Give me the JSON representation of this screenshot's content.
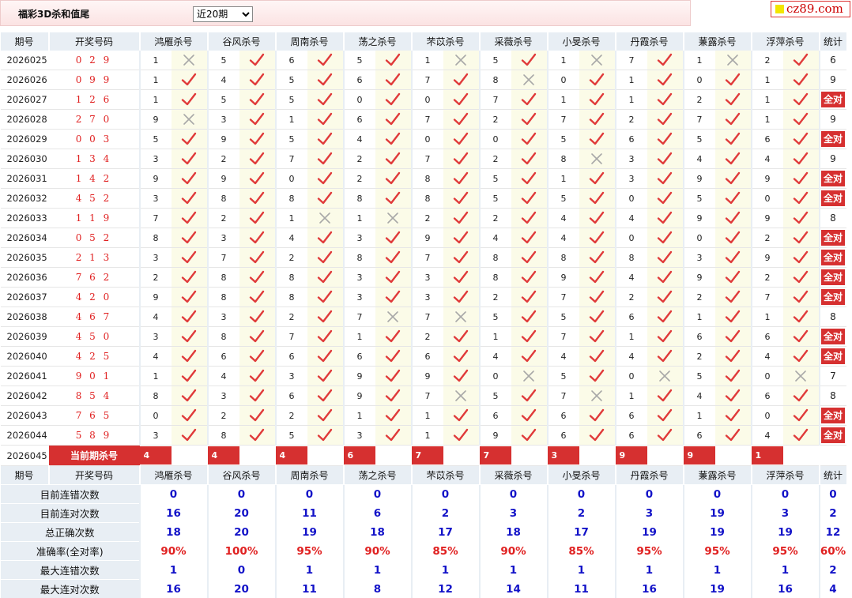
{
  "header": {
    "title": "福彩3D杀和值尾",
    "range_selected": "近20期",
    "logo_text": "cz89.com"
  },
  "columns": {
    "issue": "期号",
    "draw": "开奖号码",
    "experts": [
      "鸿雁杀号",
      "谷风杀号",
      "周南杀号",
      "荡之杀号",
      "芣苡杀号",
      "采薇杀号",
      "小旻杀号",
      "丹霞杀号",
      "蒹露杀号",
      "浮萍杀号"
    ],
    "stat": "统计"
  },
  "rows": [
    {
      "issue": "2026025",
      "draw": "0 2 9",
      "kills": [
        1,
        5,
        6,
        5,
        1,
        5,
        1,
        7,
        1,
        2
      ],
      "ok": [
        0,
        1,
        1,
        1,
        0,
        1,
        0,
        1,
        0,
        1
      ],
      "stat": "6",
      "all": false
    },
    {
      "issue": "2026026",
      "draw": "0 9 9",
      "kills": [
        1,
        4,
        5,
        6,
        7,
        8,
        0,
        1,
        0,
        1
      ],
      "ok": [
        1,
        1,
        1,
        1,
        1,
        0,
        1,
        1,
        1,
        1
      ],
      "stat": "9",
      "all": false
    },
    {
      "issue": "2026027",
      "draw": "1 2 6",
      "kills": [
        1,
        5,
        5,
        0,
        0,
        7,
        1,
        1,
        2,
        1
      ],
      "ok": [
        1,
        1,
        1,
        1,
        1,
        1,
        1,
        1,
        1,
        1
      ],
      "stat": "全对",
      "all": true
    },
    {
      "issue": "2026028",
      "draw": "2 7 0",
      "kills": [
        9,
        3,
        1,
        6,
        7,
        2,
        7,
        2,
        7,
        1
      ],
      "ok": [
        0,
        1,
        1,
        1,
        1,
        1,
        1,
        1,
        1,
        1
      ],
      "stat": "9",
      "all": false
    },
    {
      "issue": "2026029",
      "draw": "0 0 3",
      "kills": [
        5,
        9,
        5,
        4,
        0,
        0,
        5,
        6,
        5,
        6
      ],
      "ok": [
        1,
        1,
        1,
        1,
        1,
        1,
        1,
        1,
        1,
        1
      ],
      "stat": "全对",
      "all": true
    },
    {
      "issue": "2026030",
      "draw": "1 3 4",
      "kills": [
        3,
        2,
        7,
        2,
        7,
        2,
        8,
        3,
        4,
        4
      ],
      "ok": [
        1,
        1,
        1,
        1,
        1,
        1,
        0,
        1,
        1,
        1
      ],
      "stat": "9",
      "all": false
    },
    {
      "issue": "2026031",
      "draw": "1 4 2",
      "kills": [
        9,
        9,
        0,
        2,
        8,
        5,
        1,
        3,
        9,
        9
      ],
      "ok": [
        1,
        1,
        1,
        1,
        1,
        1,
        1,
        1,
        1,
        1
      ],
      "stat": "全对",
      "all": true
    },
    {
      "issue": "2026032",
      "draw": "4 5 2",
      "kills": [
        3,
        8,
        8,
        8,
        8,
        5,
        5,
        0,
        5,
        0
      ],
      "ok": [
        1,
        1,
        1,
        1,
        1,
        1,
        1,
        1,
        1,
        1
      ],
      "stat": "全对",
      "all": true
    },
    {
      "issue": "2026033",
      "draw": "1 1 9",
      "kills": [
        7,
        2,
        1,
        1,
        2,
        2,
        4,
        4,
        9,
        9
      ],
      "ok": [
        1,
        1,
        0,
        0,
        1,
        1,
        1,
        1,
        1,
        1
      ],
      "stat": "8",
      "all": false
    },
    {
      "issue": "2026034",
      "draw": "0 5 2",
      "kills": [
        8,
        3,
        4,
        3,
        9,
        4,
        4,
        0,
        0,
        2
      ],
      "ok": [
        1,
        1,
        1,
        1,
        1,
        1,
        1,
        1,
        1,
        1
      ],
      "stat": "全对",
      "all": true
    },
    {
      "issue": "2026035",
      "draw": "2 1 3",
      "kills": [
        3,
        7,
        2,
        8,
        7,
        8,
        8,
        8,
        3,
        9
      ],
      "ok": [
        1,
        1,
        1,
        1,
        1,
        1,
        1,
        1,
        1,
        1
      ],
      "stat": "全对",
      "all": true
    },
    {
      "issue": "2026036",
      "draw": "7 6 2",
      "kills": [
        2,
        8,
        8,
        3,
        3,
        8,
        9,
        4,
        9,
        2
      ],
      "ok": [
        1,
        1,
        1,
        1,
        1,
        1,
        1,
        1,
        1,
        1
      ],
      "stat": "全对",
      "all": true
    },
    {
      "issue": "2026037",
      "draw": "4 2 0",
      "kills": [
        9,
        8,
        8,
        3,
        3,
        2,
        7,
        2,
        2,
        7
      ],
      "ok": [
        1,
        1,
        1,
        1,
        1,
        1,
        1,
        1,
        1,
        1
      ],
      "stat": "全对",
      "all": true
    },
    {
      "issue": "2026038",
      "draw": "4 6 7",
      "kills": [
        4,
        3,
        2,
        7,
        7,
        5,
        5,
        6,
        1,
        1
      ],
      "ok": [
        1,
        1,
        1,
        0,
        0,
        1,
        1,
        1,
        1,
        1
      ],
      "stat": "8",
      "all": false
    },
    {
      "issue": "2026039",
      "draw": "4 5 0",
      "kills": [
        3,
        8,
        7,
        1,
        2,
        1,
        7,
        1,
        6,
        6
      ],
      "ok": [
        1,
        1,
        1,
        1,
        1,
        1,
        1,
        1,
        1,
        1
      ],
      "stat": "全对",
      "all": true
    },
    {
      "issue": "2026040",
      "draw": "4 2 5",
      "kills": [
        4,
        6,
        6,
        6,
        6,
        4,
        4,
        4,
        2,
        4
      ],
      "ok": [
        1,
        1,
        1,
        1,
        1,
        1,
        1,
        1,
        1,
        1
      ],
      "stat": "全对",
      "all": true
    },
    {
      "issue": "2026041",
      "draw": "9 0 1",
      "kills": [
        1,
        4,
        3,
        9,
        9,
        0,
        5,
        0,
        5,
        0
      ],
      "ok": [
        1,
        1,
        1,
        1,
        1,
        0,
        1,
        0,
        1,
        0
      ],
      "stat": "7",
      "all": false
    },
    {
      "issue": "2026042",
      "draw": "8 5 4",
      "kills": [
        8,
        3,
        6,
        9,
        7,
        5,
        7,
        1,
        4,
        6
      ],
      "ok": [
        1,
        1,
        1,
        1,
        0,
        1,
        0,
        1,
        1,
        1
      ],
      "stat": "8",
      "all": false
    },
    {
      "issue": "2026043",
      "draw": "7 6 5",
      "kills": [
        0,
        2,
        2,
        1,
        1,
        6,
        6,
        6,
        1,
        0
      ],
      "ok": [
        1,
        1,
        1,
        1,
        1,
        1,
        1,
        1,
        1,
        1
      ],
      "stat": "全对",
      "all": true
    },
    {
      "issue": "2026044",
      "draw": "5 8 9",
      "kills": [
        3,
        8,
        5,
        3,
        1,
        9,
        6,
        6,
        6,
        4
      ],
      "ok": [
        1,
        1,
        1,
        1,
        1,
        1,
        1,
        1,
        1,
        1
      ],
      "stat": "全对",
      "all": true
    }
  ],
  "current": {
    "issue": "2026045",
    "label": "当前期杀号",
    "kills": [
      "4",
      "4",
      "4",
      "6",
      "7",
      "7",
      "3",
      "9",
      "9",
      "1"
    ]
  },
  "summary": [
    {
      "label": "目前连错次数",
      "values": [
        "0",
        "0",
        "0",
        "0",
        "0",
        "0",
        "0",
        "0",
        "0",
        "0",
        "0"
      ],
      "type": "num"
    },
    {
      "label": "目前连对次数",
      "values": [
        "16",
        "20",
        "11",
        "6",
        "2",
        "3",
        "2",
        "3",
        "19",
        "3",
        "2"
      ],
      "type": "num"
    },
    {
      "label": "总正确次数",
      "values": [
        "18",
        "20",
        "19",
        "18",
        "17",
        "18",
        "17",
        "19",
        "19",
        "19",
        "12"
      ],
      "type": "num"
    },
    {
      "label": "准确率(全对率)",
      "values": [
        "90%",
        "100%",
        "95%",
        "90%",
        "85%",
        "90%",
        "85%",
        "95%",
        "95%",
        "95%",
        "60%"
      ],
      "type": "pct"
    },
    {
      "label": "最大连错次数",
      "values": [
        "1",
        "0",
        "1",
        "1",
        "1",
        "1",
        "1",
        "1",
        "1",
        "1",
        "2"
      ],
      "type": "num"
    },
    {
      "label": "最大连对次数",
      "values": [
        "16",
        "20",
        "11",
        "8",
        "12",
        "14",
        "11",
        "16",
        "19",
        "16",
        "4"
      ],
      "type": "num"
    }
  ],
  "colors": {
    "check": "#e03a3a",
    "cross": "#a8a8a8",
    "accent": "#d63030",
    "blue": "#1212c8"
  }
}
